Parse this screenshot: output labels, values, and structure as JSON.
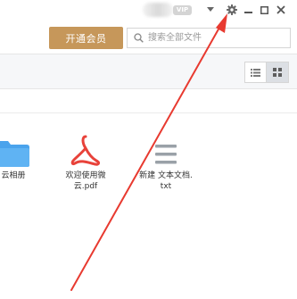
{
  "titlebar": {
    "vip_badge": "VIP",
    "icons": [
      "chevron-down-icon",
      "gear-icon",
      "minimize-icon",
      "maximize-icon",
      "close-icon"
    ]
  },
  "actionbar": {
    "vip_button_label": "开通会员",
    "search_placeholder": "搜索全部文件"
  },
  "toolbar": {
    "view_modes": [
      "list-view-icon",
      "grid-view-icon"
    ],
    "active_view": "grid"
  },
  "files": [
    {
      "name": "云相册",
      "type": "folder",
      "icon": "folder-icon"
    },
    {
      "name": "欢迎使用微云.pdf",
      "type": "pdf",
      "icon": "pdf-icon"
    },
    {
      "name": "新建 文本文档.txt",
      "type": "txt",
      "icon": "text-file-icon"
    }
  ],
  "colors": {
    "vip_button": "#c6975a",
    "annotation_arrow": "#e83a30",
    "pdf_icon": "#e8423a",
    "folder_icon": "#4aa3ec"
  }
}
